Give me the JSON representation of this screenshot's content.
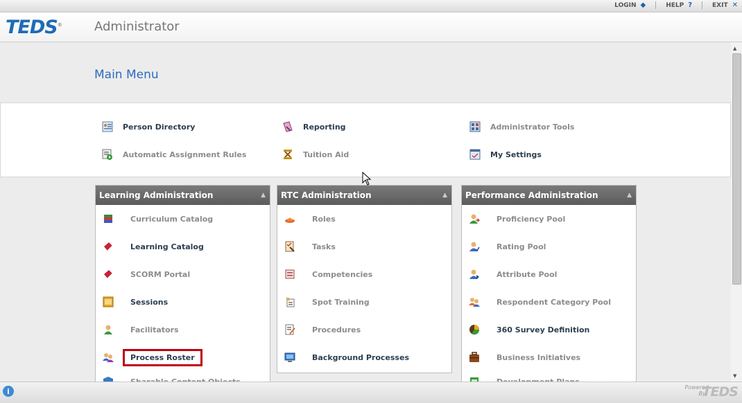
{
  "topbar": {
    "login": "LOGIN",
    "help": "HELP",
    "exit": "EXIT"
  },
  "header": {
    "logo": "TEDS",
    "app_name": "Administrator"
  },
  "main_title": "Main Menu",
  "quick_links": [
    {
      "label": "Person Directory",
      "icon": "person-directory-icon"
    },
    {
      "label": "Reporting",
      "icon": "reporting-icon"
    },
    {
      "label": "Administrator Tools",
      "icon": "admin-tools-icon"
    },
    {
      "label": "Automatic Assignment Rules",
      "icon": "assignment-rules-icon"
    },
    {
      "label": "Tuition Aid",
      "icon": "tuition-aid-icon"
    },
    {
      "label": "My Settings",
      "icon": "settings-icon"
    }
  ],
  "panels": {
    "learning": {
      "title": "Learning Administration",
      "items": [
        {
          "label": "Curriculum Catalog",
          "icon": "books-icon"
        },
        {
          "label": "Learning Catalog",
          "icon": "book-icon"
        },
        {
          "label": "SCORM Portal",
          "icon": "book-icon"
        },
        {
          "label": "Sessions",
          "icon": "calendar-icon"
        },
        {
          "label": "Facilitators",
          "icon": "person-icon"
        },
        {
          "label": "Process Roster",
          "icon": "roster-icon"
        },
        {
          "label": "Sharable Content Objects",
          "icon": "cube-icon"
        }
      ]
    },
    "rtc": {
      "title": "RTC Administration",
      "items": [
        {
          "label": "Roles",
          "icon": "hat-icon"
        },
        {
          "label": "Tasks",
          "icon": "tasks-icon"
        },
        {
          "label": "Competencies",
          "icon": "competencies-icon"
        },
        {
          "label": "Spot Training",
          "icon": "spot-training-icon"
        },
        {
          "label": "Procedures",
          "icon": "procedures-icon"
        },
        {
          "label": "Background Processes",
          "icon": "monitor-icon"
        }
      ]
    },
    "performance": {
      "title": "Performance Administration",
      "items": [
        {
          "label": "Proficiency Pool",
          "icon": "proficiency-icon"
        },
        {
          "label": "Rating Pool",
          "icon": "rating-icon"
        },
        {
          "label": "Attribute Pool",
          "icon": "attribute-icon"
        },
        {
          "label": "Respondent Category Pool",
          "icon": "respondent-icon"
        },
        {
          "label": "360 Survey Definition",
          "icon": "survey-icon"
        },
        {
          "label": "Business Initiatives",
          "icon": "briefcase-icon"
        },
        {
          "label": "Development Plans",
          "icon": "development-icon"
        }
      ]
    }
  },
  "footer": {
    "powered_line1": "Powered",
    "powered_line2": "By",
    "logo": "TEDS"
  },
  "colors": {
    "accent": "#2b6bc0",
    "highlight": "#c00012",
    "panel_header": "#666666"
  }
}
